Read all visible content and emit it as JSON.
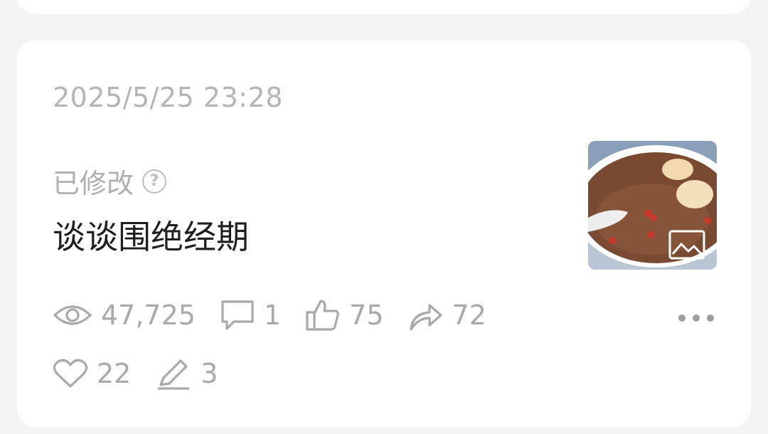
{
  "post": {
    "timestamp": "2025/5/25 23:28",
    "edited_label": "已修改",
    "help_glyph": "?",
    "title": "谈谈围绝经期",
    "thumbnail_icon": "image-icon"
  },
  "stats": {
    "views": "47,725",
    "comments": "1",
    "likes": "75",
    "shares": "72",
    "favorites": "22",
    "edits": "3"
  },
  "icons": [
    "eye-icon",
    "comment-icon",
    "thumbs-up-icon",
    "share-icon",
    "heart-icon",
    "pencil-icon",
    "more-icon",
    "help-icon"
  ],
  "colors": {
    "background": "#f3f4f6",
    "card": "#ffffff",
    "muted_text": "#b0b0b0",
    "title_text": "#1f1f1f",
    "icon_gray": "#a9a9a9"
  }
}
